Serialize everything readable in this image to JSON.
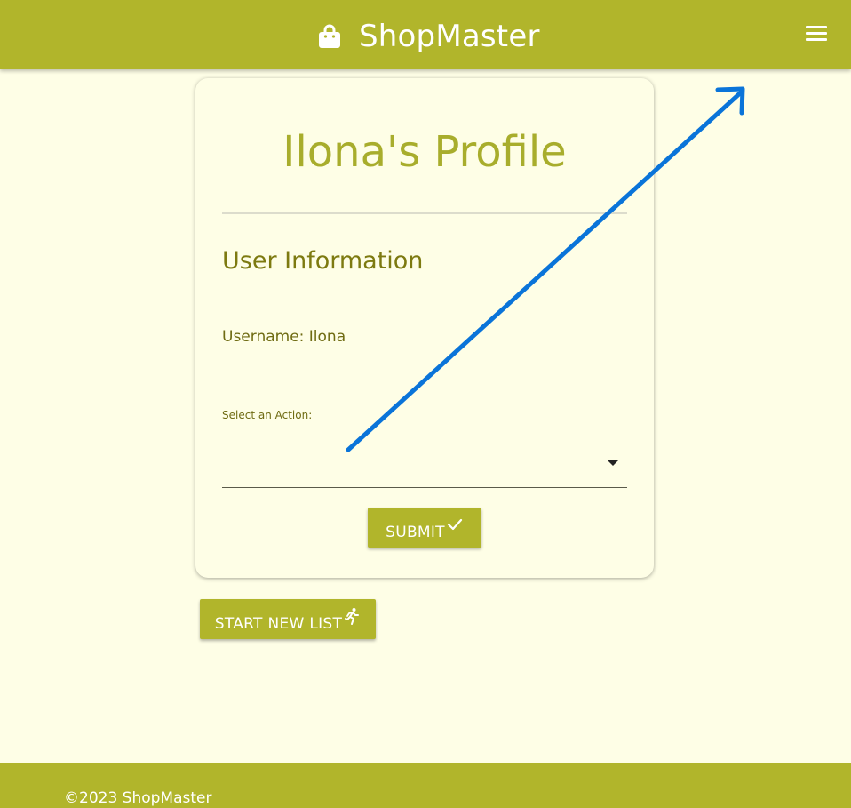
{
  "header": {
    "brand_icon": "shopping-bag-icon",
    "brand_title": "ShopMaster",
    "menu_icon": "hamburger-menu-icon"
  },
  "profile": {
    "title": "Ilona's Profile",
    "section_title": "User Information",
    "username_text": "Username: Ilona",
    "select_label": "Select an Action:",
    "select_value": "",
    "submit_label": "SUBMIT",
    "submit_icon": "checkmark-icon"
  },
  "actions": {
    "start_new_list_label": "START NEW LIST",
    "start_new_list_icon": "running-person-icon"
  },
  "footer": {
    "copyright": "©2023 ShopMaster"
  },
  "annotation": {
    "arrow_color": "#0a74d9"
  },
  "colors": {
    "brand": "#b1b52b",
    "background": "#fefee6",
    "title": "#a8ad2c",
    "text": "#6f6b12"
  }
}
